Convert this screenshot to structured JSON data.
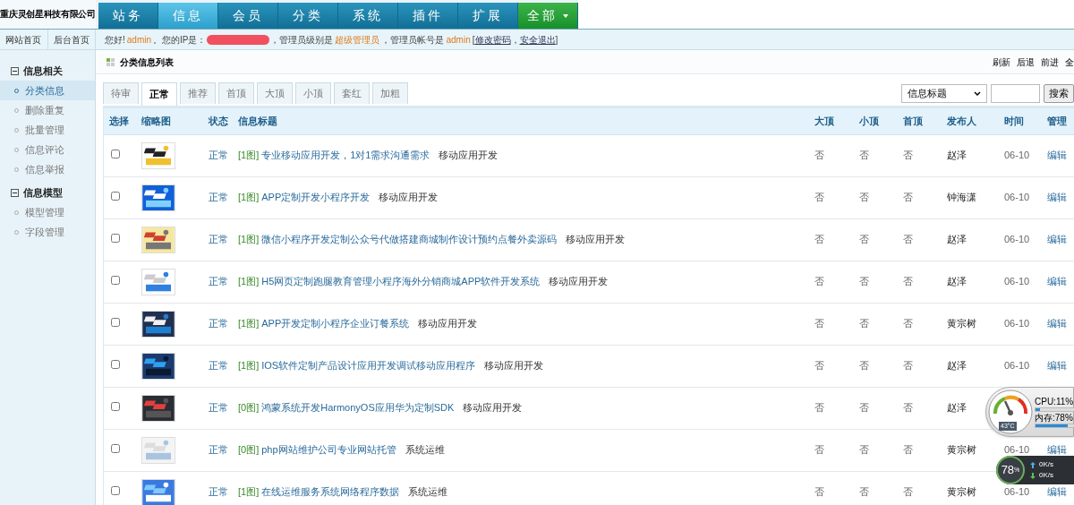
{
  "company": "重庆灵创星科技有限公司",
  "nav_tabs": [
    {
      "label": "站务",
      "selected": false,
      "kind": "normal"
    },
    {
      "label": "信息",
      "selected": true,
      "kind": "normal"
    },
    {
      "label": "会员",
      "selected": false,
      "kind": "normal"
    },
    {
      "label": "分类",
      "selected": false,
      "kind": "normal"
    },
    {
      "label": "系统",
      "selected": false,
      "kind": "normal"
    },
    {
      "label": "插件",
      "selected": false,
      "kind": "normal"
    },
    {
      "label": "扩展",
      "selected": false,
      "kind": "normal"
    },
    {
      "label": "全部",
      "selected": false,
      "kind": "menu"
    }
  ],
  "quick_links": [
    "网站首页",
    "后台首页"
  ],
  "greeting": [
    {
      "kind": "text",
      "text": "您好!"
    },
    {
      "kind": "highlight",
      "text": "admin"
    },
    {
      "kind": "text",
      "text": "。您的IP是："
    },
    {
      "kind": "redaction"
    },
    {
      "kind": "text",
      "text": "，管理员级别是"
    },
    {
      "kind": "highlight",
      "text": "超级管理员"
    },
    {
      "kind": "text",
      "text": "，管理员帐号是"
    },
    {
      "kind": "highlight",
      "text": "admin"
    },
    {
      "kind": "text",
      "text": "["
    },
    {
      "kind": "link",
      "text": "修改密码"
    },
    {
      "kind": "text",
      "text": "，"
    },
    {
      "kind": "link",
      "text": "安全退出"
    },
    {
      "kind": "text",
      "text": "]"
    }
  ],
  "sidebar": [
    {
      "label": "信息相关",
      "expanded": true,
      "children": [
        {
          "label": "分类信息",
          "selected": true
        },
        {
          "label": "删除重复",
          "selected": false
        },
        {
          "label": "批量管理",
          "selected": false
        },
        {
          "label": "信息评论",
          "selected": false
        },
        {
          "label": "信息举报",
          "selected": false
        }
      ]
    },
    {
      "label": "信息模型",
      "expanded": true,
      "children": [
        {
          "label": "模型管理",
          "selected": false
        },
        {
          "label": "字段管理",
          "selected": false
        }
      ]
    }
  ],
  "page_title": "分类信息列表",
  "toolbar": [
    "刷新",
    "后退",
    "前进",
    "全"
  ],
  "filter_tabs": [
    {
      "label": "待审",
      "selected": false
    },
    {
      "label": "正常",
      "selected": true
    },
    {
      "label": "推荐",
      "selected": false
    },
    {
      "label": "首顶",
      "selected": false
    },
    {
      "label": "大顶",
      "selected": false
    },
    {
      "label": "小顶",
      "selected": false
    },
    {
      "label": "套红",
      "selected": false
    },
    {
      "label": "加粗",
      "selected": false
    }
  ],
  "search": {
    "field": "信息标题",
    "button": "搜索"
  },
  "table": {
    "columns": [
      "选择",
      "缩略图",
      "状态",
      "信息标题",
      "大顶",
      "小顶",
      "首顶",
      "发布人",
      "时间",
      "管理"
    ],
    "rows": [
      {
        "checked": false,
        "status": "正常",
        "images": "[1图]",
        "title": "专业移动应用开发，1对1需求沟通需求",
        "category": "移动应用开发",
        "big_top": "否",
        "small_top": "否",
        "home_top": "否",
        "author": "赵泽",
        "time": "06-10",
        "action": "编辑"
      },
      {
        "checked": false,
        "status": "正常",
        "images": "[1图]",
        "title": "APP定制开发小程序开发",
        "category": "移动应用开发",
        "big_top": "否",
        "small_top": "否",
        "home_top": "否",
        "author": "钟海潇",
        "time": "06-10",
        "action": "编辑"
      },
      {
        "checked": false,
        "status": "正常",
        "images": "[1图]",
        "title": "微信小程序开发定制公众号代做搭建商城制作设计预约点餐外卖源码",
        "category": "移动应用开发",
        "big_top": "否",
        "small_top": "否",
        "home_top": "否",
        "author": "赵泽",
        "time": "06-10",
        "action": "编辑"
      },
      {
        "checked": false,
        "status": "正常",
        "images": "[1图]",
        "title": "H5网页定制跑腿教育管理小程序海外分销商城APP软件开发系统",
        "category": "移动应用开发",
        "big_top": "否",
        "small_top": "否",
        "home_top": "否",
        "author": "赵泽",
        "time": "06-10",
        "action": "编辑"
      },
      {
        "checked": false,
        "status": "正常",
        "images": "[1图]",
        "title": "APP开发定制小程序企业订餐系统",
        "category": "移动应用开发",
        "big_top": "否",
        "small_top": "否",
        "home_top": "否",
        "author": "黄宗树",
        "time": "06-10",
        "action": "编辑"
      },
      {
        "checked": false,
        "status": "正常",
        "images": "[1图]",
        "title": "IOS软件定制产品设计应用开发调试移动应用程序",
        "category": "移动应用开发",
        "big_top": "否",
        "small_top": "否",
        "home_top": "否",
        "author": "赵泽",
        "time": "06-10",
        "action": "编辑"
      },
      {
        "checked": false,
        "status": "正常",
        "images": "[0图]",
        "title": "鸿蒙系统开发HarmonyOS应用华为定制SDK",
        "category": "移动应用开发",
        "big_top": "否",
        "small_top": "否",
        "home_top": "否",
        "author": "赵泽"
      },
      {
        "checked": false,
        "status": "正常",
        "images": "[0图]",
        "title": "php网站维护公司专业网站托管",
        "category": "系统运维",
        "big_top": "否",
        "small_top": "否",
        "home_top": "否",
        "author": "黄宗树",
        "time": "06-10",
        "action": "编辑"
      },
      {
        "checked": false,
        "status": "正常",
        "images": "[1图]",
        "title": "在线运维服务系统网络程序数据",
        "category": "系统运维",
        "big_top": "否",
        "small_top": "否",
        "home_top": "否",
        "author": "黄宗树",
        "time": "06-10",
        "action": "编辑"
      }
    ]
  },
  "monitor": {
    "temperature": "43°C",
    "cpu": {
      "label": "CPU:11%",
      "level": 0.11
    },
    "memory": {
      "label": "内存:78%",
      "level": 0.78
    }
  },
  "speed_widget": {
    "value": "78",
    "unit": "%",
    "upload": "0K/s",
    "download": "0K/s"
  }
}
